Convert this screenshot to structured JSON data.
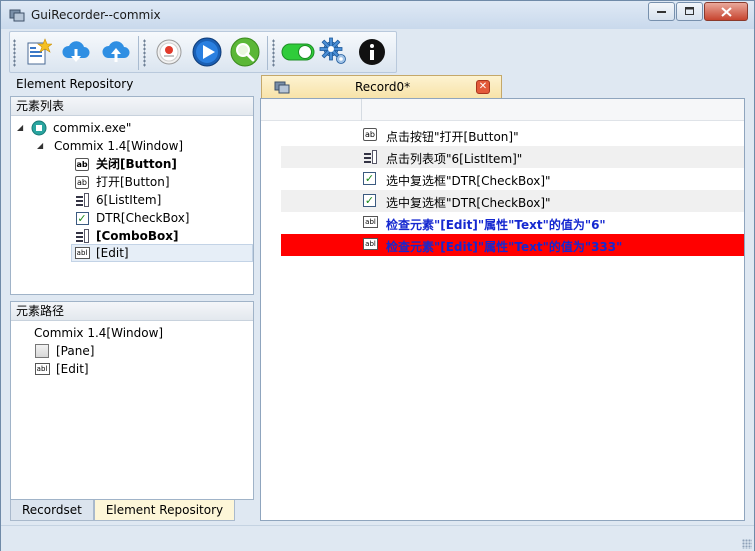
{
  "window": {
    "title": "GuiRecorder--commix"
  },
  "toolbar": {
    "buttons": [
      {
        "icon": "new-document-icon"
      },
      {
        "icon": "cloud-download-icon"
      },
      {
        "icon": "cloud-upload-icon"
      },
      {
        "icon": "record-icon"
      },
      {
        "icon": "play-icon"
      },
      {
        "icon": "search-icon"
      },
      {
        "icon": "toggle-icon"
      },
      {
        "icon": "settings-gear-icon"
      },
      {
        "icon": "info-icon"
      }
    ]
  },
  "repository": {
    "title": "Element Repository",
    "element_list_header": "元素列表",
    "tree": [
      {
        "label": "commix.exe\"",
        "icon": "app-icon",
        "bold": false
      },
      {
        "label": "Commix 1.4[Window]",
        "icon": "none",
        "bold": false
      },
      {
        "label": "关闭[Button]",
        "icon": "button-icon",
        "bold": true
      },
      {
        "label": "打开[Button]",
        "icon": "button-icon",
        "bold": false
      },
      {
        "label": "6[ListItem]",
        "icon": "list-icon",
        "bold": false
      },
      {
        "label": "DTR[CheckBox]",
        "icon": "checkbox-icon",
        "bold": false
      },
      {
        "label": "[ComboBox]",
        "icon": "list-icon",
        "bold": true
      },
      {
        "label": "[Edit]",
        "icon": "edit-icon",
        "bold": false
      }
    ],
    "path_header": "元素路径",
    "path": [
      {
        "label": "Commix 1.4[Window]",
        "icon": "none"
      },
      {
        "label": "[Pane]",
        "icon": "pane-icon"
      },
      {
        "label": "[Edit]",
        "icon": "edit-icon"
      }
    ]
  },
  "bottom_tabs": [
    {
      "label": "Recordset"
    },
    {
      "label": "Element Repository"
    }
  ],
  "record": {
    "tab_label": "Record0*",
    "rows": [
      {
        "text": "点击按钮\"打开[Button]\"",
        "icon": "button-icon",
        "style": "normal"
      },
      {
        "text": "点击列表项\"6[ListItem]\"",
        "icon": "list-icon",
        "style": "alt"
      },
      {
        "text": "选中复选框\"DTR[CheckBox]\"",
        "icon": "checkbox-icon",
        "style": "normal"
      },
      {
        "text": "选中复选框\"DTR[CheckBox]\"",
        "icon": "checkbox-icon",
        "style": "alt"
      },
      {
        "text": "检查元素\"[Edit]\"属性\"Text\"的值为\"6\"",
        "icon": "edit-icon",
        "style": "blue"
      },
      {
        "text": "检查元素\"[Edit]\"属性\"Text\"的值为\"333\"",
        "icon": "edit-icon",
        "style": "error"
      }
    ]
  },
  "colors": {
    "error_row": "#ff0000",
    "check_text": "#1528d0",
    "doc_tab": "#f7e2a7"
  }
}
